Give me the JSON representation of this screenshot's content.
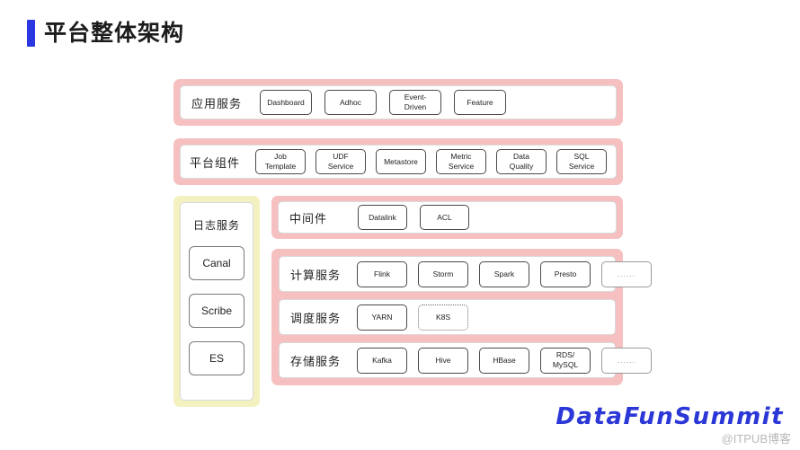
{
  "page": {
    "title": "平台整体架构",
    "accent_color": "#2b37e0",
    "pink_color": "#f6c0c0",
    "yellow_color": "#f4f1c0"
  },
  "rows": {
    "app": {
      "label": "应用服务",
      "items": [
        {
          "line1": "Dashboard",
          "line2": ""
        },
        {
          "line1": "Adhoc",
          "line2": ""
        },
        {
          "line1": "Event-",
          "line2": "Driven"
        },
        {
          "line1": "Feature",
          "line2": ""
        }
      ]
    },
    "platform": {
      "label": "平台组件",
      "items": [
        {
          "line1": "Job",
          "line2": "Template"
        },
        {
          "line1": "UDF",
          "line2": "Service"
        },
        {
          "line1": "Metastore",
          "line2": ""
        },
        {
          "line1": "Metric",
          "line2": "Service"
        },
        {
          "line1": "Data",
          "line2": "Quality"
        },
        {
          "line1": "SQL",
          "line2": "Service"
        }
      ]
    },
    "middleware": {
      "label": "中间件",
      "items": [
        {
          "line1": "Datalink",
          "line2": ""
        },
        {
          "line1": "ACL",
          "line2": ""
        }
      ]
    },
    "compute": {
      "label": "计算服务",
      "items": [
        {
          "line1": "Flink",
          "line2": ""
        },
        {
          "line1": "Storm",
          "line2": ""
        },
        {
          "line1": "Spark",
          "line2": ""
        },
        {
          "line1": "Presto",
          "line2": ""
        },
        {
          "line1": "......",
          "line2": "",
          "style": "ellipsis"
        }
      ]
    },
    "schedule": {
      "label": "调度服务",
      "items": [
        {
          "line1": "YARN",
          "line2": ""
        },
        {
          "line1": "K8S",
          "line2": "",
          "style": "dotted"
        }
      ]
    },
    "storage": {
      "label": "存储服务",
      "items": [
        {
          "line1": "Kafka",
          "line2": ""
        },
        {
          "line1": "Hive",
          "line2": ""
        },
        {
          "line1": "HBase",
          "line2": ""
        },
        {
          "line1": "RDS/",
          "line2": "MySQL"
        },
        {
          "line1": "......",
          "line2": "",
          "style": "ellipsis"
        }
      ]
    },
    "log": {
      "label": "日志服务",
      "items": [
        {
          "line1": "Canal"
        },
        {
          "line1": "Scribe"
        },
        {
          "line1": "ES"
        }
      ]
    }
  },
  "footer": {
    "brand": "DataFunSummit",
    "watermark": "@ITPUB博客"
  }
}
